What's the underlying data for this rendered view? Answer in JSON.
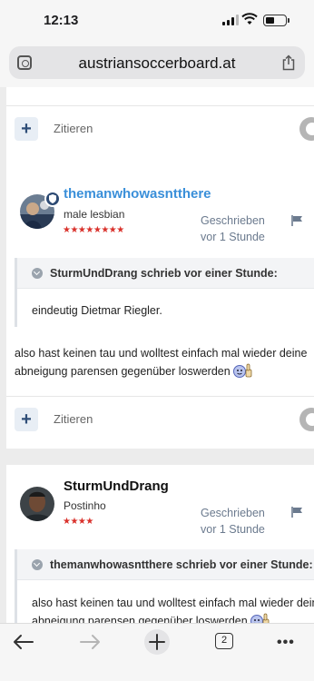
{
  "status_bar": {
    "time": "12:13"
  },
  "browser": {
    "url": "austriansoccerboard.at",
    "tab_count": "2"
  },
  "post_actions": {
    "quote_label": "Zitieren"
  },
  "posts": [
    {
      "username": "themanwhowasntthere",
      "rank": "male lesbian",
      "stars": "★★★★★★★★",
      "written_line1": "Geschrieben",
      "written_line2": "vor 1 Stunde",
      "quote_header": "SturmUndDrang schrieb vor einer Stunde:",
      "quote_text": "eindeutig Dietmar Riegler.",
      "message_line1": "also hast keinen tau und wolltest einfach mal wieder deine",
      "message_line2": "abneigung parensen gegenüber loswerden"
    },
    {
      "username": "SturmUndDrang",
      "rank": "Postinho",
      "stars": "★★★★",
      "written_line1": "Geschrieben",
      "written_line2": "vor 1 Stunde",
      "quote_header": "themanwhowasntthere schrieb vor einer Stunde:",
      "quote_text_line1": "also hast keinen tau und wolltest einfach mal wieder deine",
      "quote_text_line2": "abneigung parensen gegenüber loswerden"
    }
  ],
  "colors": {
    "username_link": "#3a8fd9",
    "accent_navy": "#2d4a73",
    "stars": "#d9312b"
  }
}
